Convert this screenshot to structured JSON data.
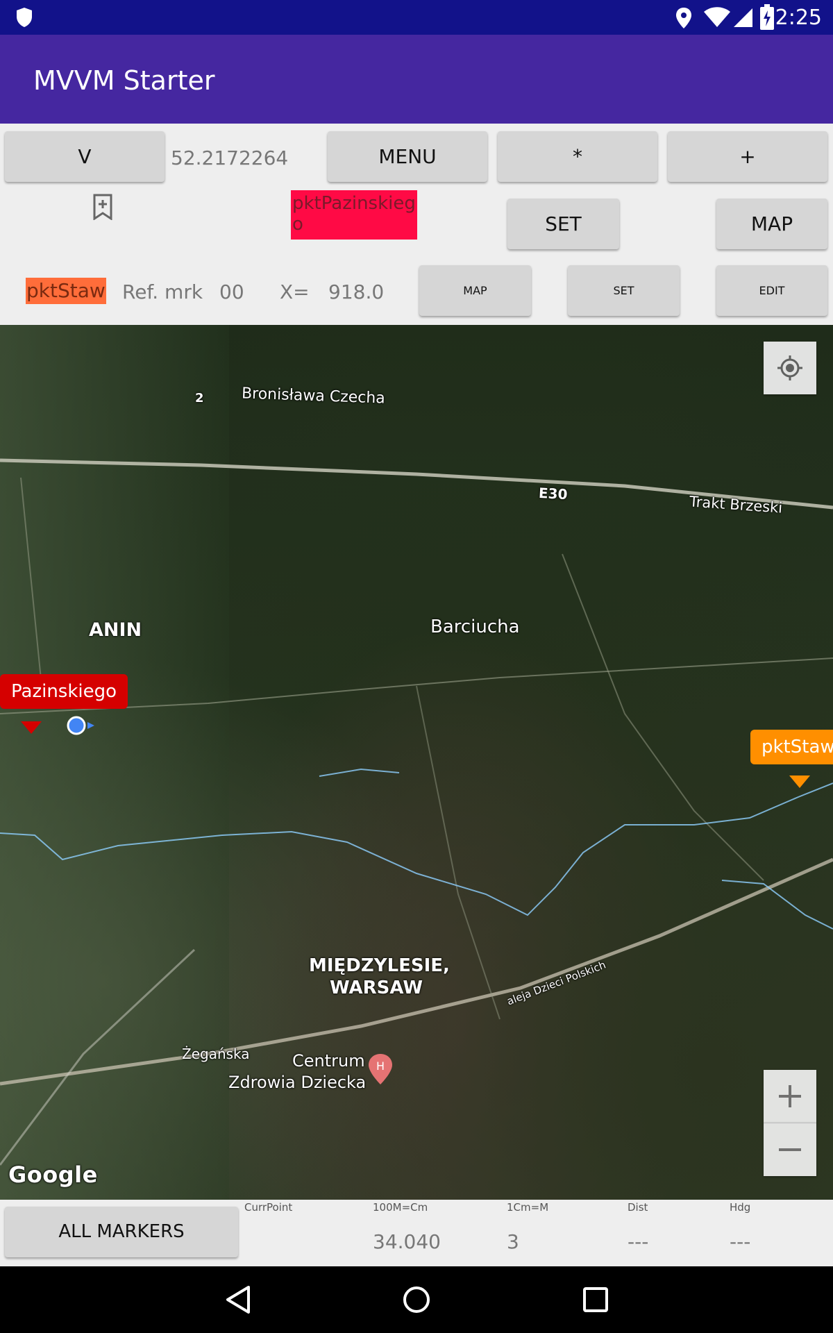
{
  "status_bar": {
    "time": "2:25",
    "icons": [
      "shield-icon",
      "location-icon",
      "wifi-icon",
      "signal-icon",
      "battery-icon"
    ]
  },
  "app_bar": {
    "title": "MVVM Starter"
  },
  "controls": {
    "row1": {
      "v_label": "V",
      "coord_value": "52.2172264",
      "menu_label": "MENU",
      "star_label": "*",
      "plus_label": "+"
    },
    "row2": {
      "bookmark_icon": "bookmark-add-icon",
      "marker_name": "pktPazinskiego",
      "set_label": "SET",
      "map_label": "MAP"
    },
    "row3": {
      "marker_name": "pktStaw",
      "ref_label": "Ref. mrk",
      "ref_value": "00",
      "x_label": "X=",
      "x_value": "918.0",
      "map_label": "MAP",
      "set_label": "SET",
      "edit_label": "EDIT"
    }
  },
  "map": {
    "labels": {
      "road_number": "2",
      "road_name": "Bronisława Czecha",
      "highway": "E30",
      "road_east": "Trakt Brzeski",
      "area_anin": "ANIN",
      "area_barciucha": "Barciucha",
      "area_miedzylesie_1": "MIĘDZYLESIE,",
      "area_miedzylesie_2": "WARSAW",
      "street_aleja": "aleja Dzieci Polskich",
      "street_zeganska": "Żegańska",
      "poi_1": "Centrum",
      "poi_2": "Zdrowia Dziecka",
      "google": "Google"
    },
    "markers": {
      "left": "Pazinskiego",
      "right": "pktStaw"
    },
    "colors": {
      "marker_left": "#d50000",
      "marker_right": "#ff8f00",
      "route": "#9fd4ff"
    }
  },
  "bottom_bar": {
    "all_markers_label": "ALL MARKERS",
    "headers": [
      "CurrPoint",
      "100M=Cm",
      "1Cm=M",
      "Dist",
      "Hdg"
    ],
    "values": [
      "",
      "34.040",
      "3",
      "---",
      "---"
    ]
  },
  "nav_bar": {
    "icons": [
      "back-icon",
      "home-icon",
      "recents-icon"
    ]
  }
}
